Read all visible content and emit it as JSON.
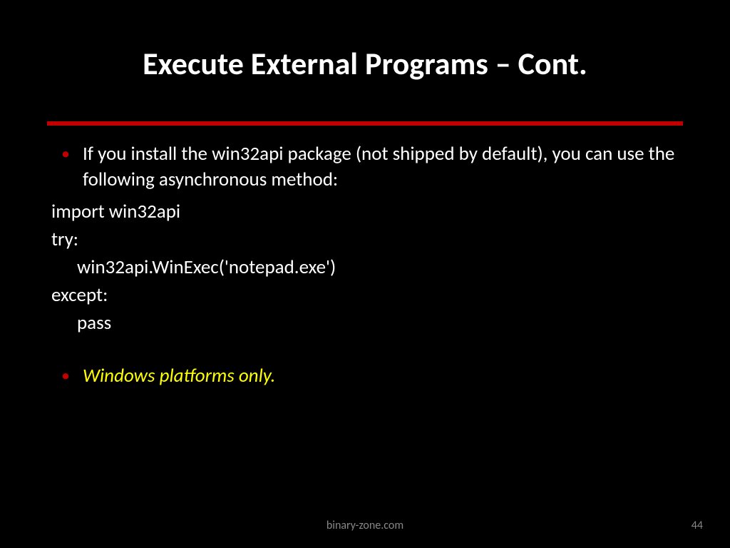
{
  "title": "Execute External Programs – Cont.",
  "bullet1": "If you install the win32api package (not shipped by default), you can use the following asynchronous method:",
  "code": {
    "l1": "import win32api",
    "l2": "try:",
    "l3": "win32api.WinExec('notepad.exe')",
    "l4": "except:",
    "l5": "pass"
  },
  "bullet2": "Windows platforms only.",
  "footer": {
    "site": "binary-zone.com",
    "page": "44"
  }
}
